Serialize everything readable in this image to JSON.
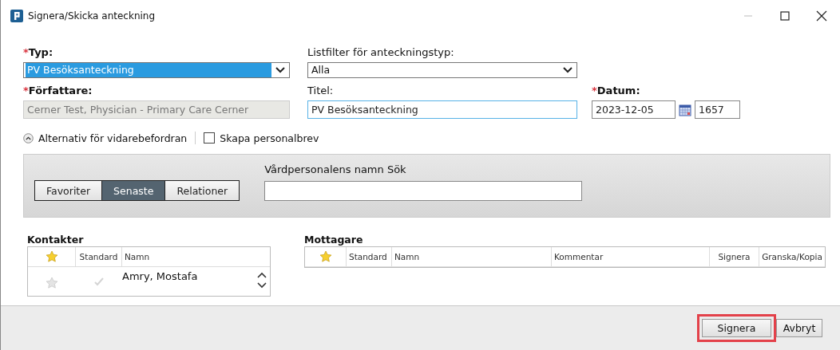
{
  "window": {
    "title": "Signera/Skicka anteckning"
  },
  "fields": {
    "type": {
      "required_mark": "*",
      "label": "Typ:",
      "value": "PV Besöksanteckning",
      "highlighted": true
    },
    "list_filter": {
      "label": "Listfilter för anteckningstyp:",
      "value": "Alla"
    },
    "author": {
      "required_mark": "*",
      "label": "Författare:",
      "value": "Cerner Test, Physician - Primary Care Cerner",
      "disabled": true
    },
    "title": {
      "label": "Titel:",
      "value": "PV Besöksanteckning",
      "focused": true
    },
    "date": {
      "required_mark": "*",
      "label": "Datum:",
      "value": "2023-12-05",
      "time": "1657"
    }
  },
  "forwarding": {
    "label": "Alternativ för vidarebefordran",
    "expanded": true
  },
  "personal_letter": {
    "label": "Skapa personalbrev",
    "checked": false
  },
  "tabs": [
    {
      "label": "Favoriter",
      "selected": false
    },
    {
      "label": "Senaste",
      "selected": true
    },
    {
      "label": "Relationer",
      "selected": false
    }
  ],
  "search": {
    "label": "Vårdpersonalens namn Sök"
  },
  "contacts": {
    "title": "Kontakter",
    "columns": [
      "Standard",
      "Namn"
    ],
    "rows": [
      {
        "name": "Amry, Mostafa",
        "favorite": false,
        "standard": false
      }
    ]
  },
  "recipients": {
    "title": "Mottagare",
    "columns": [
      "Standard",
      "Namn",
      "Kommentar",
      "Signera",
      "Granska/Kopia"
    ]
  },
  "buttons": [
    {
      "label": "Signera",
      "highlighted": true
    },
    {
      "label": "Avbryt",
      "highlighted": false
    }
  ]
}
